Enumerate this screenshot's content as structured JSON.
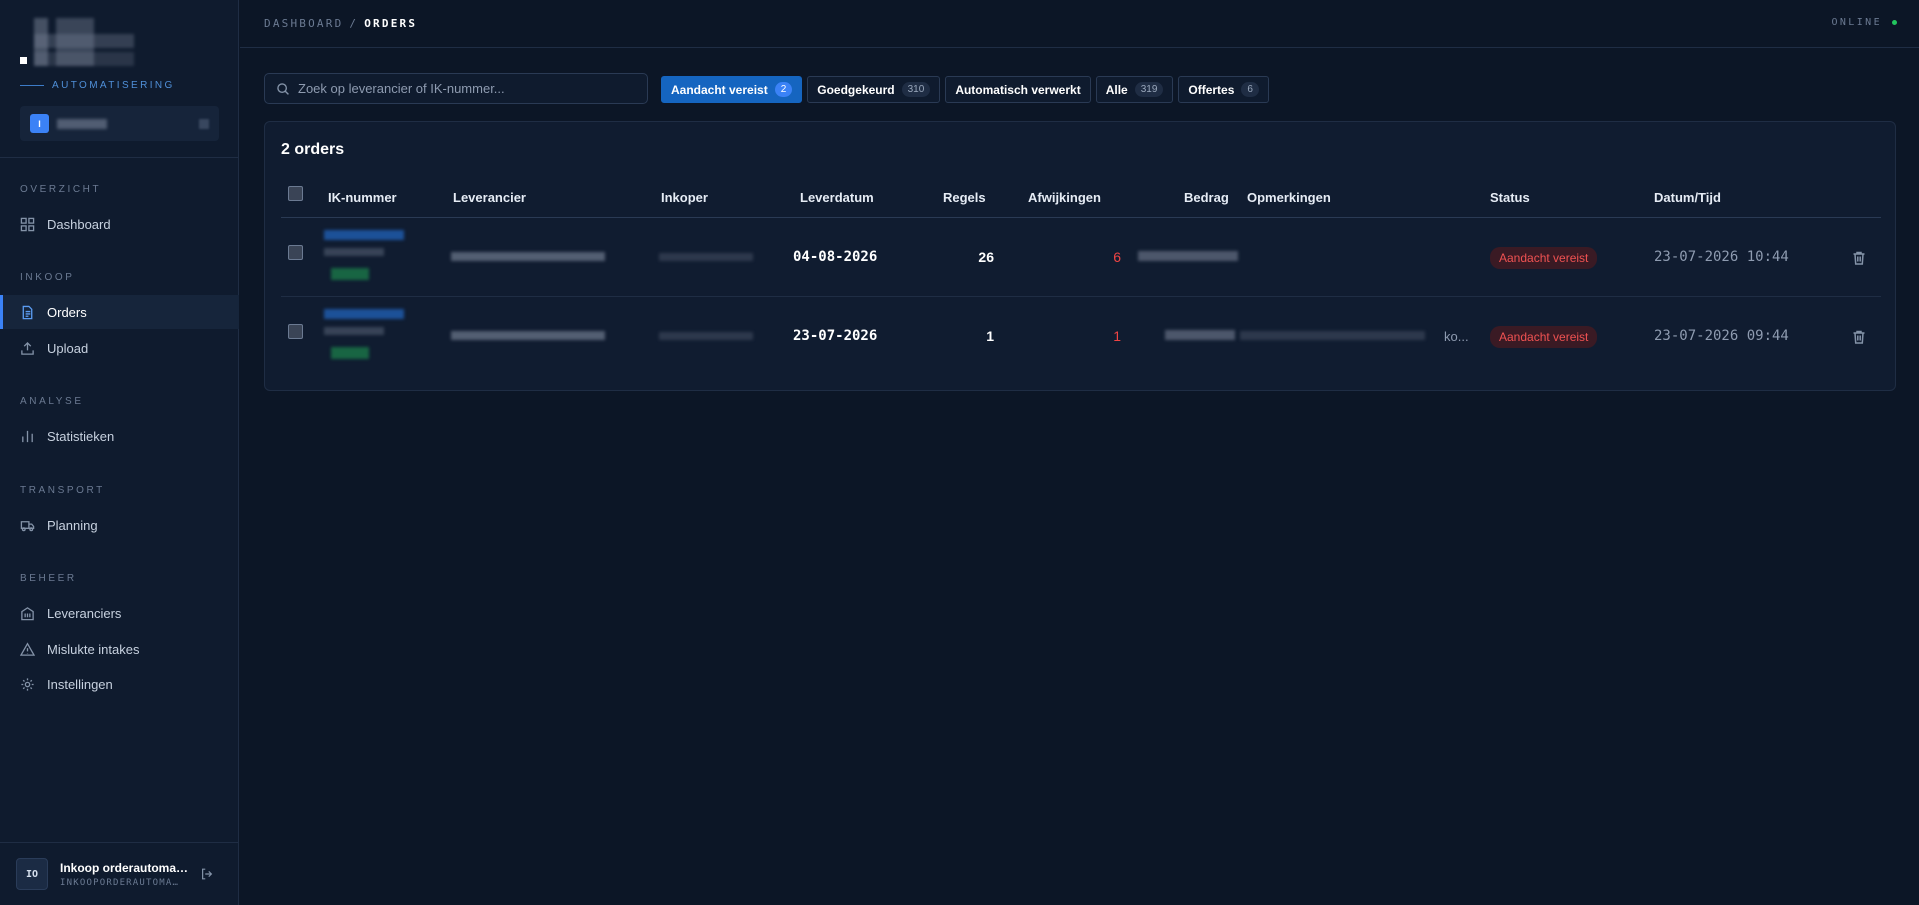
{
  "sidebar": {
    "tagline": "AUTOMATISERING",
    "org_initial": "I",
    "sections": [
      {
        "label": "OVERZICHT",
        "items": [
          {
            "label": "Dashboard",
            "icon": "grid-icon"
          }
        ]
      },
      {
        "label": "INKOOP",
        "items": [
          {
            "label": "Orders",
            "icon": "document-icon",
            "active": true
          },
          {
            "label": "Upload",
            "icon": "upload-icon"
          }
        ]
      },
      {
        "label": "ANALYSE",
        "items": [
          {
            "label": "Statistieken",
            "icon": "bar-chart-icon"
          }
        ]
      },
      {
        "label": "TRANSPORT",
        "items": [
          {
            "label": "Planning",
            "icon": "truck-icon"
          }
        ]
      },
      {
        "label": "BEHEER",
        "items": [
          {
            "label": "Leveranciers",
            "icon": "building-icon"
          },
          {
            "label": "Mislukte intakes",
            "icon": "warning-icon"
          },
          {
            "label": "Instellingen",
            "icon": "gear-icon"
          }
        ]
      }
    ],
    "user": {
      "initials": "IO",
      "name": "Inkoop orderautoma…",
      "sub": "INKOOPORDERAUTOMA…"
    }
  },
  "topbar": {
    "breadcrumb_root": "DASHBOARD",
    "breadcrumb_sep": "/",
    "breadcrumb_current": "ORDERS",
    "status": "ONLINE"
  },
  "search": {
    "placeholder": "Zoek op leverancier of IK-nummer..."
  },
  "filters": [
    {
      "label": "Aandacht vereist",
      "count": "2",
      "active": true
    },
    {
      "label": "Goedgekeurd",
      "count": "310"
    },
    {
      "label": "Automatisch verwerkt",
      "count": ""
    },
    {
      "label": "Alle",
      "count": "319"
    },
    {
      "label": "Offertes",
      "count": "6"
    }
  ],
  "table": {
    "title": "2 orders",
    "columns": [
      "IK-nummer",
      "Leverancier",
      "Inkoper",
      "Leverdatum",
      "Regels",
      "Afwijkingen",
      "Bedrag",
      "Opmerkingen",
      "Status",
      "Datum/Tijd"
    ],
    "rows": [
      {
        "leverdatum": "04-08-2026",
        "regels": "26",
        "afwijkingen": "6",
        "opmerkingen": "",
        "status": "Aandacht vereist",
        "datum_tijd": "23-07-2026 10:44"
      },
      {
        "leverdatum": "23-07-2026",
        "regels": "1",
        "afwijkingen": "1",
        "opmerkingen": "ko...",
        "status": "Aandacht vereist",
        "datum_tijd": "23-07-2026 09:44"
      }
    ]
  },
  "colors": {
    "accent": "#3b82f6",
    "active_filter": "#1565c0",
    "danger": "#ef4444",
    "online": "#22c55e"
  }
}
